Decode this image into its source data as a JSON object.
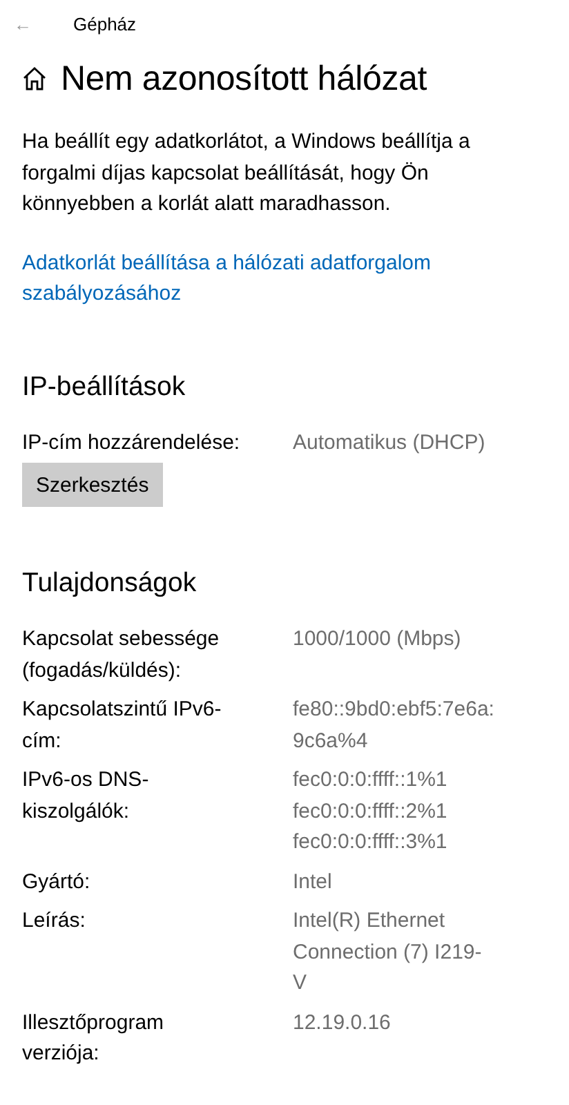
{
  "header": {
    "back_glyph": "←",
    "app_title": "Gépház"
  },
  "page_title": "Nem azonosított hálózat",
  "description": "Ha beállít egy adatkorlátot, a Windows beállítja a forgalmi díjas kapcsolat beállítását, hogy Ön könnyebben a korlát alatt maradhasson.",
  "link": "Adatkorlát beállítása a hálózati adatforgalom szabályozásához",
  "ip_settings": {
    "heading": "IP-beállítások",
    "label": "IP-cím hozzárendelése:",
    "value": "Automatikus (DHCP)",
    "button": "Szerkesztés"
  },
  "properties": {
    "heading": "Tulajdonságok",
    "rows": [
      {
        "label": [
          "Kapcsolat sebessége",
          "(fogadás/küldés):"
        ],
        "value": [
          "1000/1000 (Mbps)"
        ]
      },
      {
        "label": [
          "Kapcsolatszintű IPv6-",
          "cím:"
        ],
        "value": [
          "fe80::9bd0:ebf5:7e6a:",
          "9c6a%4"
        ]
      },
      {
        "label": [
          "IPv6-os DNS-",
          "kiszolgálók:"
        ],
        "value": [
          "fec0:0:0:ffff::1%1",
          "fec0:0:0:ffff::2%1",
          "fec0:0:0:ffff::3%1"
        ]
      },
      {
        "label": [
          "Gyártó:"
        ],
        "value": [
          "Intel"
        ]
      },
      {
        "label": [
          "Leírás:"
        ],
        "value": [
          "Intel(R) Ethernet",
          "Connection (7) I219-",
          "V"
        ]
      },
      {
        "label": [
          "Illesztőprogram",
          "verziója:"
        ],
        "value": [
          "12.19.0.16"
        ]
      }
    ]
  }
}
